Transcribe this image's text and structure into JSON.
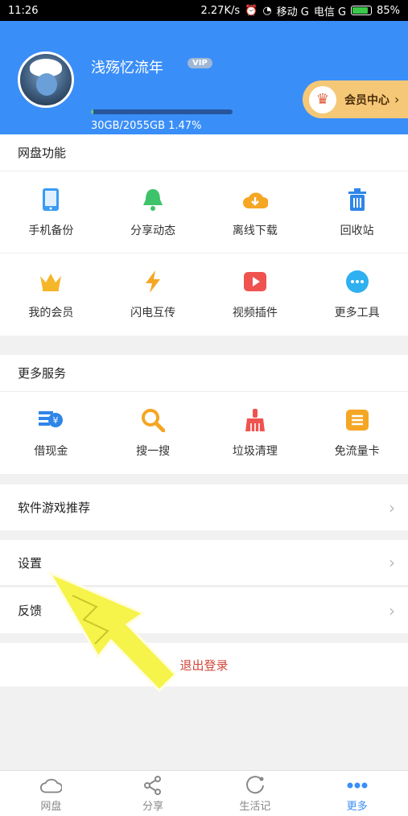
{
  "status_bar": {
    "time": "11:26",
    "speed": "2.27K/s",
    "carrier1": "移动 G",
    "carrier2": "电信 G",
    "battery": "85%",
    "battery_level": 0.85
  },
  "profile": {
    "username": "浅殇忆流年",
    "vip_badge": "VIP",
    "storage_text": "30GB/2055GB 1.47%",
    "storage_fraction": 0.0147
  },
  "vip_center": {
    "label": "会员中心"
  },
  "disk_features": {
    "title": "网盘功能",
    "items": [
      {
        "label": "手机备份",
        "icon": "phone-icon",
        "color": "#3a9bf4"
      },
      {
        "label": "分享动态",
        "icon": "bell-icon",
        "color": "#3fc36a"
      },
      {
        "label": "离线下载",
        "icon": "cloud-download-icon",
        "color": "#f5a623"
      },
      {
        "label": "回收站",
        "icon": "trash-icon",
        "color": "#2f86e8"
      },
      {
        "label": "我的会员",
        "icon": "crown-icon",
        "color": "#f5b62a"
      },
      {
        "label": "闪电互传",
        "icon": "lightning-icon",
        "color": "#f5a623"
      },
      {
        "label": "视频插件",
        "icon": "video-play-icon",
        "color": "#ef5350"
      },
      {
        "label": "更多工具",
        "icon": "more-dots-icon",
        "color": "#2fb0f0"
      }
    ]
  },
  "more_services": {
    "title": "更多服务",
    "items": [
      {
        "label": "借现金",
        "icon": "cash-icon",
        "color": "#2f86e8"
      },
      {
        "label": "搜一搜",
        "icon": "search-icon",
        "color": "#f5a623"
      },
      {
        "label": "垃圾清理",
        "icon": "broom-icon",
        "color": "#ef5350"
      },
      {
        "label": "免流量卡",
        "icon": "card-icon",
        "color": "#f5a623"
      }
    ]
  },
  "list": {
    "recommend": "软件游戏推荐",
    "settings": "设置",
    "feedback": "反馈",
    "logout": "退出登录"
  },
  "tabs": [
    {
      "label": "网盘",
      "icon": "cloud-icon"
    },
    {
      "label": "分享",
      "icon": "share-icon"
    },
    {
      "label": "生活记",
      "icon": "life-icon"
    },
    {
      "label": "更多",
      "icon": "more-icon"
    }
  ],
  "colors": {
    "header": "#3a8ef8",
    "accent": "#3a8ef8",
    "logout": "#d2453a",
    "vip": "#f5c877"
  }
}
